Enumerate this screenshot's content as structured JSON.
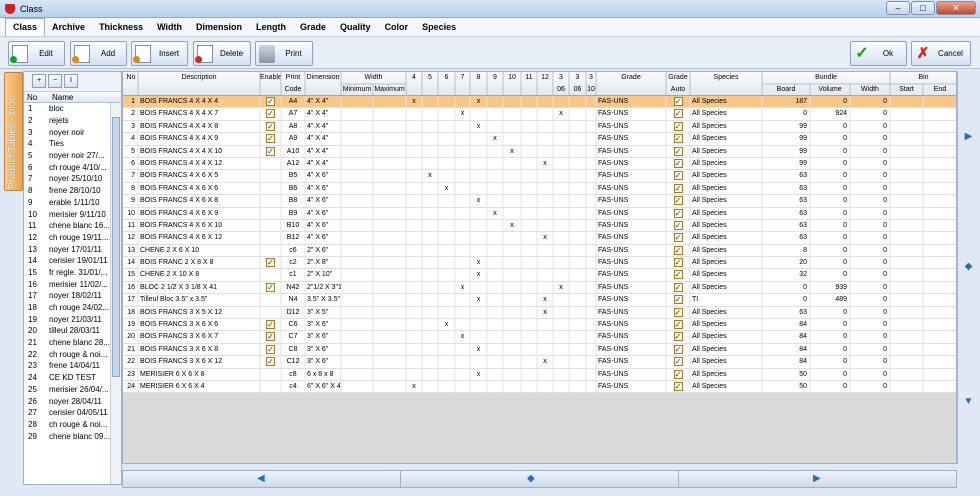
{
  "window": {
    "title": "Class"
  },
  "window_controls": {
    "minimize": "–",
    "maximize": "□",
    "close": "✕"
  },
  "menu": [
    "Class",
    "Archive",
    "Thickness",
    "Width",
    "Dimension",
    "Length",
    "Grade",
    "Quality",
    "Color",
    "Species"
  ],
  "toolbar": {
    "edit": "Edit",
    "add": "Add",
    "insert": "Insert",
    "delete": "Delete",
    "print": "Print",
    "ok": "Ok",
    "cancel": "Cancel"
  },
  "side_tab": "Product Tables - bloc",
  "left_panel": {
    "headers": {
      "no": "No",
      "name": "Name"
    },
    "rows": [
      {
        "no": "1",
        "name": "bloc"
      },
      {
        "no": "2",
        "name": "rejets"
      },
      {
        "no": "3",
        "name": "noyer noir"
      },
      {
        "no": "4",
        "name": "Ties"
      },
      {
        "no": "5",
        "name": "noyer noir 27/..."
      },
      {
        "no": "6",
        "name": "ch rouge 4/10/..."
      },
      {
        "no": "7",
        "name": "noyer 25/10/10"
      },
      {
        "no": "8",
        "name": "frene 28/10/10"
      },
      {
        "no": "9",
        "name": "erable 1/11/10"
      },
      {
        "no": "10",
        "name": "merisier 9/11/10"
      },
      {
        "no": "11",
        "name": "chene blanc 16..."
      },
      {
        "no": "12",
        "name": "ch rouge 19/11..."
      },
      {
        "no": "13",
        "name": "noyer 17/01/11"
      },
      {
        "no": "14",
        "name": "cerisier 19/01/11"
      },
      {
        "no": "15",
        "name": "fr regle. 31/01/..."
      },
      {
        "no": "16",
        "name": "merisier 11/02/..."
      },
      {
        "no": "17",
        "name": "noyer 18/02/11"
      },
      {
        "no": "18",
        "name": "ch rouge 24/02..."
      },
      {
        "no": "19",
        "name": "noyer 21/03/11"
      },
      {
        "no": "20",
        "name": "tilleul 28/03/11"
      },
      {
        "no": "21",
        "name": "chene blanc 28..."
      },
      {
        "no": "22",
        "name": "ch rouge & noi..."
      },
      {
        "no": "23",
        "name": "frene 14/04/11"
      },
      {
        "no": "24",
        "name": "CE KD TEST"
      },
      {
        "no": "25",
        "name": "merisier 26/04/..."
      },
      {
        "no": "26",
        "name": "noyer 28/04/11"
      },
      {
        "no": "27",
        "name": "cerisier 04/05/11"
      },
      {
        "no": "28",
        "name": "ch rouge & noi..."
      },
      {
        "no": "29",
        "name": "chene blanc 09..."
      }
    ]
  },
  "grid": {
    "headers": {
      "no": "No",
      "description": "Description",
      "enable": "Enable",
      "print_code": [
        "Print",
        "Code"
      ],
      "dimension": "Dimension",
      "width": "Width",
      "minimum": "Minimum",
      "maximum": "Maximum",
      "thk": [
        "4",
        "5",
        "6",
        "7",
        "8",
        "9",
        "10",
        "11",
        "12",
        "3",
        "3",
        "3"
      ],
      "thk2": [
        "",
        "",
        "",
        "",
        "",
        "",
        "",
        "",
        "",
        "06",
        "06",
        "10"
      ],
      "grade": "Grade",
      "grade_auto": [
        "Grade",
        "Auto"
      ],
      "species": "Species",
      "bundle": "Bundle",
      "board": "Board",
      "volume": "Volume",
      "bwidth": "Width",
      "bin": "Bin",
      "start": "Start",
      "end": "End"
    },
    "rows": [
      {
        "no": "1",
        "desc": "BOIS FRANCS 4 X 4 X 4",
        "en": true,
        "code": "A4",
        "dim": "4\" X 4\"",
        "x": [
          0,
          4
        ],
        "grade": "FAS-UNS",
        "species": "All Species",
        "board": "187",
        "volume": "0",
        "width": "0"
      },
      {
        "no": "2",
        "desc": "BOIS FRANCS 4 X 4 X 7",
        "en": true,
        "code": "A7",
        "dim": "4\" X 4\"",
        "x": [
          3,
          9
        ],
        "grade": "FAS-UNS",
        "species": "All Species",
        "board": "0",
        "volume": "924",
        "width": "0"
      },
      {
        "no": "3",
        "desc": "BOIS FRANCS 4 X 4 X 8",
        "en": true,
        "code": "A8",
        "dim": "4\" X 4\"",
        "x": [
          4
        ],
        "grade": "FAS-UNS",
        "species": "All Species",
        "board": "99",
        "volume": "0",
        "width": "0"
      },
      {
        "no": "4",
        "desc": "BOIS FRANCS 4 X 4 X 9",
        "en": true,
        "code": "A9",
        "dim": "4\" X 4\"",
        "x": [
          5
        ],
        "grade": "FAS-UNS",
        "species": "All Species",
        "board": "99",
        "volume": "0",
        "width": "0"
      },
      {
        "no": "5",
        "desc": "BOIS FRANCS 4 X 4 X 10",
        "en": true,
        "code": "A10",
        "dim": "4\" X 4\"",
        "x": [
          6
        ],
        "grade": "FAS-UNS",
        "species": "All Species",
        "board": "99",
        "volume": "0",
        "width": "0"
      },
      {
        "no": "6",
        "desc": "BOIS FRANCS 4 X 4 X 12",
        "en": false,
        "code": "A12",
        "dim": "4\" X 4\"",
        "x": [
          8
        ],
        "grade": "FAS-UNS",
        "species": "All Species",
        "board": "99",
        "volume": "0",
        "width": "0"
      },
      {
        "no": "7",
        "desc": "BOIS FRANCS 4 X 6 X 5",
        "en": false,
        "code": "B5",
        "dim": "4\" X 6\"",
        "x": [
          1
        ],
        "grade": "FAS-UNS",
        "species": "All Species",
        "board": "63",
        "volume": "0",
        "width": "0"
      },
      {
        "no": "8",
        "desc": "BOIS FRANCS 4 X 6 X 6",
        "en": false,
        "code": "B6",
        "dim": "4\" X 6\"",
        "x": [
          2
        ],
        "grade": "FAS-UNS",
        "species": "All Species",
        "board": "63",
        "volume": "0",
        "width": "0"
      },
      {
        "no": "9",
        "desc": "BOIS FRANCS 4 X 6 X 8",
        "en": false,
        "code": "B8",
        "dim": "4\" X 6\"",
        "x": [
          4
        ],
        "grade": "FAS-UNS",
        "species": "All Species",
        "board": "63",
        "volume": "0",
        "width": "0"
      },
      {
        "no": "10",
        "desc": "BOIS FRANCS 4 X 6 X 9",
        "en": false,
        "code": "B9",
        "dim": "4\" X 6\"",
        "x": [
          5
        ],
        "grade": "FAS-UNS",
        "species": "All Species",
        "board": "63",
        "volume": "0",
        "width": "0"
      },
      {
        "no": "11",
        "desc": "BOIS FRANCS 4 X 6 X 10",
        "en": false,
        "code": "B10",
        "dim": "4\" X 6\"",
        "x": [
          6
        ],
        "grade": "FAS-UNS",
        "species": "All Species",
        "board": "63",
        "volume": "0",
        "width": "0"
      },
      {
        "no": "12",
        "desc": "BOIS FRANCS 4 X 6 X 12",
        "en": false,
        "code": "B12",
        "dim": "4\" X 6\"",
        "x": [
          8
        ],
        "grade": "FAS-UNS",
        "species": "All Species",
        "board": "63",
        "volume": "0",
        "width": "0"
      },
      {
        "no": "13",
        "desc": "CHENE 2 X 6 X 10",
        "en": false,
        "code": "c6",
        "dim": "2\" X 6\"",
        "x": [],
        "grade": "FAS-UNS",
        "species": "All Species",
        "board": "8",
        "volume": "0",
        "width": "0"
      },
      {
        "no": "14",
        "desc": "BOIS FRANC 2 X 8 X 8",
        "en": true,
        "code": "c2",
        "dim": "2\" X 8\"",
        "x": [
          4
        ],
        "grade": "FAS-UNS",
        "species": "All Species",
        "board": "20",
        "volume": "0",
        "width": "0"
      },
      {
        "no": "15",
        "desc": "CHENE 2 X 10 X 8",
        "en": false,
        "code": "c1",
        "dim": "2\" X 10\"",
        "x": [
          4
        ],
        "grade": "FAS-UNS",
        "species": "All Species",
        "board": "32",
        "volume": "0",
        "width": "0"
      },
      {
        "no": "16",
        "desc": "BLOC 2 1/2 X 3 1/8 X 41",
        "en": true,
        "code": "N42",
        "dim": "2\"1/2 X 3\"1",
        "x": [
          3,
          9
        ],
        "grade": "FAS-UNS",
        "species": "All Species",
        "board": "0",
        "volume": "939",
        "width": "0"
      },
      {
        "no": "17",
        "desc": "Tilleul Bloc 3.5\" x 3.5\"",
        "en": false,
        "code": "N4",
        "dim": "3.5\" X 3.5\"",
        "x": [
          4,
          8
        ],
        "grade": "FAS-UNS",
        "species": "TI",
        "board": "0",
        "volume": "489",
        "width": "0"
      },
      {
        "no": "18",
        "desc": "BOIS FRANCS 3 X 5 X 12",
        "en": false,
        "code": "D12",
        "dim": "3\" X 5\"",
        "x": [
          8
        ],
        "grade": "FAS-UNS",
        "species": "All Species",
        "board": "63",
        "volume": "0",
        "width": "0"
      },
      {
        "no": "19",
        "desc": "BOIS FRANCS 3 X 6 X 6",
        "en": true,
        "code": "C6",
        "dim": "3\" X 6\"",
        "x": [
          2
        ],
        "grade": "FAS-UNS",
        "species": "All Species",
        "board": "84",
        "volume": "0",
        "width": "0"
      },
      {
        "no": "20",
        "desc": "BOIS FRANCS 3 X 6 X 7",
        "en": true,
        "code": "C7",
        "dim": "3\" X 6\"",
        "x": [
          3
        ],
        "grade": "FAS-UNS",
        "species": "All Species",
        "board": "84",
        "volume": "0",
        "width": "0"
      },
      {
        "no": "21",
        "desc": "BOIS FRANCS 3 X 6 X 8",
        "en": true,
        "code": "C8",
        "dim": "3\" X 6\"",
        "x": [
          4
        ],
        "grade": "FAS-UNS",
        "species": "All Species",
        "board": "84",
        "volume": "0",
        "width": "0"
      },
      {
        "no": "22",
        "desc": "BOIS FRANCS 3 X 6 X 12",
        "en": true,
        "code": "C12",
        "dim": "3\" X 6\"",
        "x": [
          8
        ],
        "grade": "FAS-UNS",
        "species": "All Species",
        "board": "84",
        "volume": "0",
        "width": "0"
      },
      {
        "no": "23",
        "desc": "MERISIER 6 X 6 X 8",
        "en": false,
        "code": "c8",
        "dim": "6 x 8 x 8",
        "x": [
          4
        ],
        "grade": "FAS-UNS",
        "species": "All Species",
        "board": "50",
        "volume": "0",
        "width": "0"
      },
      {
        "no": "24",
        "desc": "MERISIER 6 X 6 X 4",
        "en": false,
        "code": "c4",
        "dim": "6\" X 6\" X 4",
        "x": [
          0
        ],
        "grade": "FAS-UNS",
        "species": "All Species",
        "board": "50",
        "volume": "0",
        "width": "0"
      }
    ],
    "mark": "x"
  },
  "colors": {
    "selected_row": "#f8c88a",
    "enable_column": "#ffff00",
    "accent": "#2a6cc4"
  }
}
